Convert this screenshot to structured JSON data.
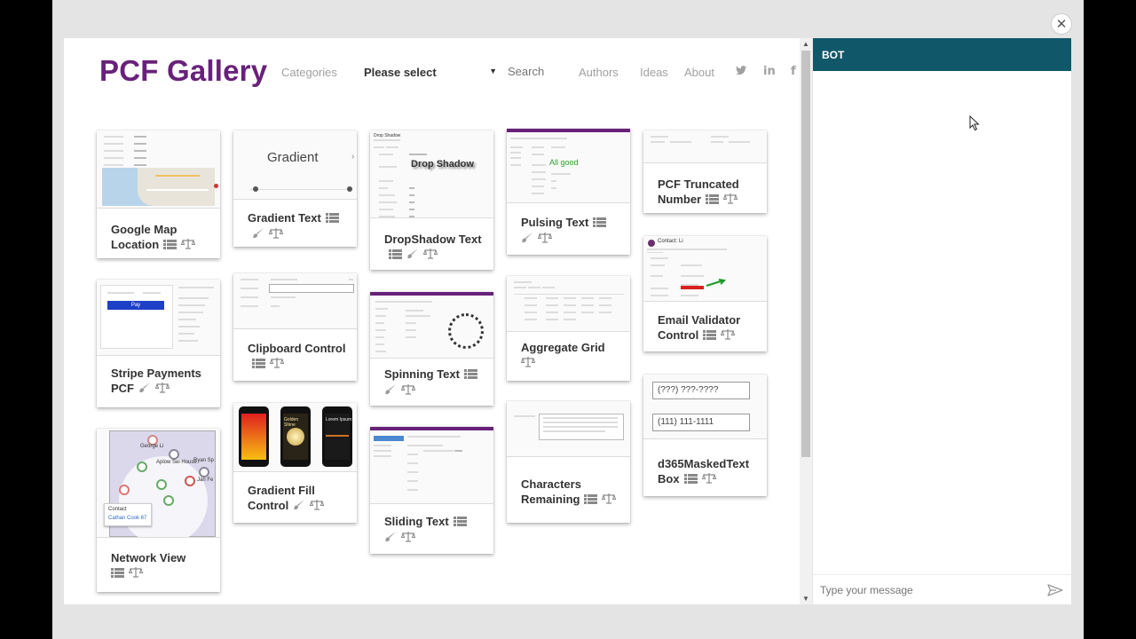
{
  "site": {
    "logo": "PCF Gallery",
    "nav": {
      "categories": "Categories",
      "select_value": "Please select",
      "search_placeholder": "Search",
      "authors": "Authors",
      "ideas": "Ideas",
      "about": "About"
    },
    "social_icons": [
      "twitter-icon",
      "linkedin-icon",
      "facebook-icon"
    ]
  },
  "cards": [
    {
      "id": "google-map-location",
      "title": "Google Map Location"
    },
    {
      "id": "stripe-payments-pcf",
      "title": "Stripe Payments PCF",
      "thumb": {
        "button": "Pay"
      }
    },
    {
      "id": "network-view",
      "title": "Network View",
      "thumb": {
        "node_labels": [
          "George Li",
          "Aplow Sei House",
          "Ryan Sp",
          "Jan Fe"
        ],
        "popup_title": "Contact",
        "popup_value": "Cathan Cook 67"
      }
    },
    {
      "id": "gradient-text",
      "title": "Gradient Text",
      "thumb": {
        "text": "Gradient"
      }
    },
    {
      "id": "clipboard-control",
      "title": "Clipboard Control"
    },
    {
      "id": "gradient-fill-control",
      "title": "Gradient Fill Control",
      "thumb": {
        "phone2_label": "Golden Shine",
        "phone3_label": "Lorem Ipsum"
      }
    },
    {
      "id": "dropshadow-text",
      "title": "DropShadow Text",
      "thumb": {
        "heading": "Drop Shadow",
        "text": "Drop Shadow"
      }
    },
    {
      "id": "spinning-text",
      "title": "Spinning Text"
    },
    {
      "id": "sliding-text",
      "title": "Sliding Text"
    },
    {
      "id": "pulsing-text",
      "title": "Pulsing Text",
      "thumb": {
        "text": "All good"
      }
    },
    {
      "id": "aggregate-grid",
      "title": "Aggregate Grid"
    },
    {
      "id": "characters-remaining",
      "title": "Characters Remaining"
    },
    {
      "id": "pcf-truncated-number",
      "title": "PCF Truncated Number"
    },
    {
      "id": "email-validator-control",
      "title": "Email Validator Control",
      "thumb": {
        "contact": "Contact: Li"
      }
    },
    {
      "id": "d365maskedtext-box",
      "title": "d365MaskedText Box",
      "thumb": {
        "mask1": "(???) ???-????",
        "mask2": "(111) 111-1111"
      }
    }
  ],
  "bot": {
    "title": "BOT",
    "input_placeholder": "Type your message"
  },
  "icons": [
    "close-icon",
    "dataset-icon",
    "brush-icon",
    "license-icon",
    "send-icon",
    "mouse-cursor-icon"
  ],
  "colors": {
    "logo": "#68217a",
    "bot_header": "#11576a",
    "stripe_button": "#1e40c8",
    "success": "#2e9e2e",
    "error": "#d92020"
  }
}
